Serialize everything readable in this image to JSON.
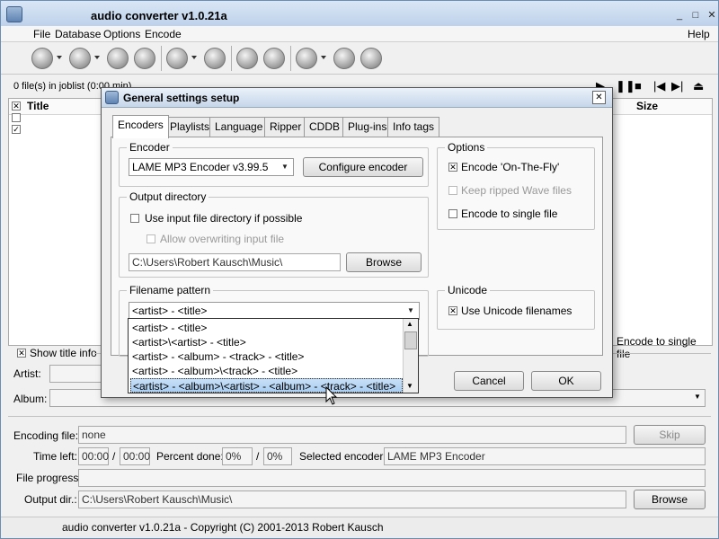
{
  "window": {
    "title": "audio converter v1.0.21a",
    "min": "_",
    "max": "□",
    "close": "✕"
  },
  "menu": {
    "items": [
      "File",
      "Database",
      "Options",
      "Encode"
    ],
    "help": "Help"
  },
  "joblist": {
    "status": "0 file(s) in joblist (0:00 min)",
    "col_title": "Title",
    "col_size": "Size",
    "encode_single": "Encode to single file"
  },
  "info": {
    "show_title_info": "Show title info",
    "artist_label": "Artist:",
    "album_label": "Album:"
  },
  "encoding": {
    "file_label": "Encoding file:",
    "file_value": "none",
    "skip": "Skip",
    "time_left_label": "Time left:",
    "time1": "00:00",
    "slash": "/",
    "time2": "00:00",
    "percent_label": "Percent done:",
    "pct1": "0%",
    "pct2": "0%",
    "selected_encoder_label": "Selected encoder:",
    "selected_encoder": "LAME MP3 Encoder",
    "progress_label": "File progress:",
    "output_label": "Output dir.:",
    "output_value": "C:\\Users\\Robert Kausch\\Music\\",
    "browse": "Browse"
  },
  "status": "audio converter v1.0.21a - Copyright (C) 2001-2013 Robert Kausch",
  "dialog": {
    "title": "General settings setup",
    "close": "✕",
    "tabs": [
      "Encoders",
      "Playlists",
      "Language",
      "Ripper",
      "CDDB",
      "Plug-ins",
      "Info tags"
    ],
    "encoder_group": "Encoder",
    "encoder_value": "LAME MP3 Encoder v3.99.5",
    "configure": "Configure encoder",
    "options_group": "Options",
    "opt_onthefly": "Encode 'On-The-Fly'",
    "opt_keepwave": "Keep ripped Wave files",
    "opt_single": "Encode to single file",
    "output_group": "Output directory",
    "use_input_dir": "Use input file directory if possible",
    "allow_overwrite": "Allow overwriting input file",
    "output_path": "C:\\Users\\Robert Kausch\\Music\\",
    "browse": "Browse",
    "filename_group": "Filename pattern",
    "pattern_value": "<artist> - <title>",
    "pattern_options": [
      "<artist> - <title>",
      "<artist>\\<artist> - <title>",
      "<artist> - <album> - <track> - <title>",
      "<artist> - <album>\\<track> - <title>",
      "<artist> - <album>\\<artist> - <album> - <track> - <title>"
    ],
    "unicode_group": "Unicode",
    "use_unicode": "Use Unicode filenames",
    "cancel": "Cancel",
    "ok": "OK"
  }
}
